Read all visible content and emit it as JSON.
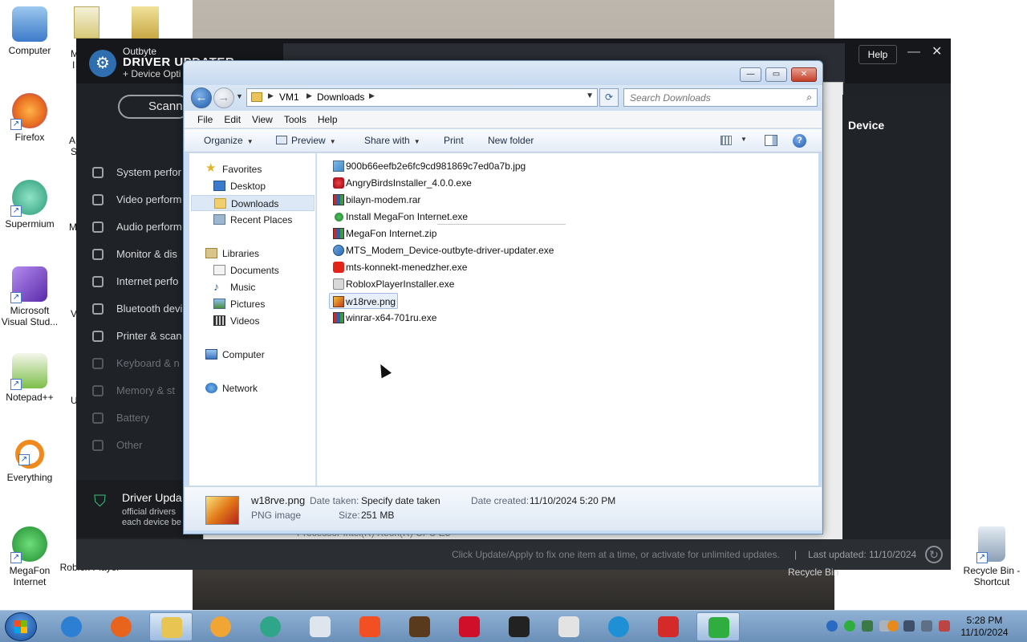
{
  "desktop": {
    "icons": [
      {
        "label": "Computer",
        "color": "#3d7ac9"
      },
      {
        "label": "Firefox",
        "color": "#e66a1f"
      },
      {
        "label": "Supermium",
        "color": "#2a9a78"
      },
      {
        "label": "Microsoft Visual Stud...",
        "color": "#7a4cc3"
      },
      {
        "label": "Notepad++",
        "color": "#7cbf4a"
      },
      {
        "label": "Everything",
        "color": "#f08a1c"
      },
      {
        "label": "MegaFon Internet",
        "color": "#2fae3f"
      },
      {
        "label": "Roblox Player",
        "color": "#cccccc"
      },
      {
        "label": "Recycle Bin - Shortcut",
        "color": "#8aa0b5"
      }
    ],
    "partial_labels": [
      "M",
      "I",
      "A",
      "S",
      "M",
      "V",
      "U"
    ]
  },
  "outbyte": {
    "brand_line1": "Outbyte",
    "brand_line2": "DRIVER UPDATER",
    "brand_line3": "+ Device Opti",
    "help_label": "Help",
    "minimize_glyph": "—",
    "close_glyph": "✕",
    "scan_label": "Scann",
    "sidebar": [
      {
        "label": "System perfor",
        "dim": false
      },
      {
        "label": "Video perform",
        "dim": false
      },
      {
        "label": "Audio perform",
        "dim": false
      },
      {
        "label": "Monitor & dis",
        "dim": false
      },
      {
        "label": "Internet perfo",
        "dim": false
      },
      {
        "label": "Bluetooth devi",
        "dim": false
      },
      {
        "label": "Printer & scan",
        "dim": false
      },
      {
        "label": "Keyboard & n",
        "dim": true
      },
      {
        "label": "Memory & st",
        "dim": true
      },
      {
        "label": "Battery",
        "dim": true
      },
      {
        "label": "Other",
        "dim": true
      }
    ],
    "footer_title": "Driver Upda",
    "footer_sub": "official drivers\neach device be",
    "device_label": "Device",
    "status_text": "Click Update/Apply to fix one item at a time, or activate for unlimited updates.",
    "status_sep": "|",
    "last_updated": "Last updated: 11/10/2024",
    "processor_text": "Processor  Intel(R) Xeon(R) CPU E5",
    "recycle_label": "Recycle Bin"
  },
  "explorer": {
    "title_buttons": {
      "minimize": "—",
      "maximize": "▭",
      "close": "✕"
    },
    "address": {
      "crumbs": [
        "VM1",
        "Downloads"
      ]
    },
    "search_placeholder": "Search Downloads",
    "menu": [
      "File",
      "Edit",
      "View",
      "Tools",
      "Help"
    ],
    "toolbar": {
      "organize": "Organize",
      "preview": "Preview",
      "share_with": "Share with",
      "print": "Print",
      "new_folder": "New folder"
    },
    "nav": {
      "favorites": "Favorites",
      "desktop": "Desktop",
      "downloads": "Downloads",
      "recent": "Recent Places",
      "libraries": "Libraries",
      "documents": "Documents",
      "music": "Music",
      "pictures": "Pictures",
      "videos": "Videos",
      "computer": "Computer",
      "network": "Network"
    },
    "files": [
      {
        "name": "900b66eefb2e6fc9cd981869c7ed0a7b.jpg",
        "icon": "img"
      },
      {
        "name": "AngryBirdsInstaller_4.0.0.exe",
        "icon": "angry"
      },
      {
        "name": "bilayn-modem.rar",
        "icon": "rar"
      },
      {
        "name": "Install MegaFon Internet.exe",
        "icon": "megafon"
      },
      {
        "name": "MegaFon Internet.zip",
        "icon": "rar"
      },
      {
        "name": "MTS_Modem_Device-outbyte-driver-updater.exe",
        "icon": "mts"
      },
      {
        "name": "mts-konnekt-menedzher.exe",
        "icon": "mtsk"
      },
      {
        "name": "RobloxPlayerInstaller.exe",
        "icon": "roblox"
      },
      {
        "name": "w18rve.png",
        "icon": "pngimg",
        "selected": true
      },
      {
        "name": "winrar-x64-701ru.exe",
        "icon": "rar"
      }
    ],
    "details": {
      "filename": "w18rve.png",
      "filetype": "PNG image",
      "date_taken_label": "Date taken:",
      "date_taken_value": "Specify date taken",
      "size_label": "Size:",
      "size_value": "251 MB",
      "date_created_label": "Date created:",
      "date_created_value": "11/10/2024 5:20 PM"
    }
  },
  "taskbar": {
    "apps": [
      {
        "name": "internet-explorer",
        "color": "#2d7fd3"
      },
      {
        "name": "firefox",
        "color": "#e8641c"
      },
      {
        "name": "file-explorer",
        "color": "#e8c553"
      },
      {
        "name": "media-player",
        "color": "#f0a534"
      },
      {
        "name": "supermium",
        "color": "#2fa58a"
      },
      {
        "name": "youtube-player",
        "color": "#dfe5ec"
      },
      {
        "name": "microsoft-store",
        "color": "#f25022"
      },
      {
        "name": "ups",
        "color": "#5a3a1c"
      },
      {
        "name": "bank-of-america",
        "color": "#d0102b"
      },
      {
        "name": "shopping-bag",
        "color": "#222222"
      },
      {
        "name": "roblox",
        "color": "#e3e3e3"
      },
      {
        "name": "edge",
        "color": "#1f8fd6"
      },
      {
        "name": "angry-birds",
        "color": "#d42a2a"
      },
      {
        "name": "megafon",
        "color": "#2fae3f"
      }
    ],
    "clock_time": "5:28 PM",
    "clock_date": "11/10/2024"
  }
}
